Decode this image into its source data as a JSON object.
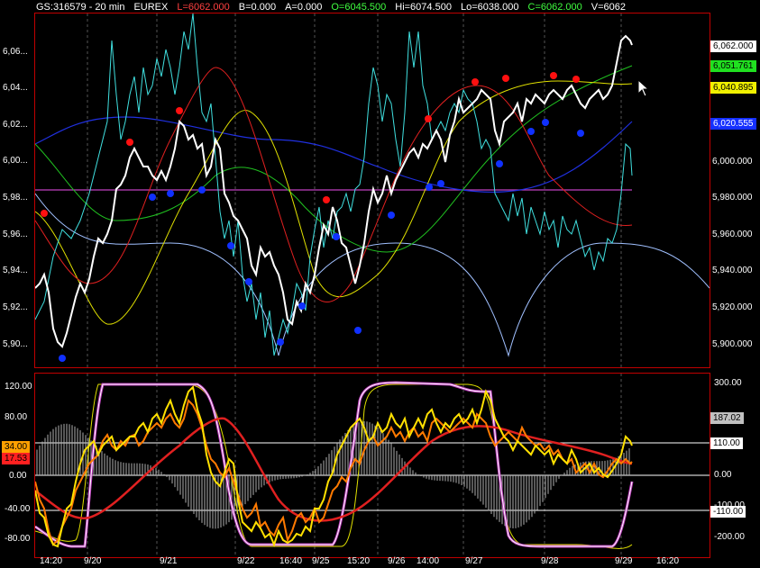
{
  "header": {
    "symbol": "GS:316579 - 20 min",
    "exchange": "EUREX",
    "last": "L=6062.000",
    "bid": "B=0.000",
    "ask": "A=0.000",
    "open": "O=6045.500",
    "high": "Hi=6074.500",
    "low": "Lo=6038.000",
    "close": "C=6062.000",
    "volume": "V=6062"
  },
  "price_axis": {
    "left_ticks": [
      "6,06...",
      "6,04...",
      "6,02...",
      "6,00...",
      "5,98...",
      "5,96...",
      "5,94...",
      "5,92...",
      "5,90..."
    ],
    "right_ticks": [
      "6,000.000",
      "5,980.000",
      "5,960.000",
      "5,940.000",
      "5,920.000",
      "5,900.000"
    ],
    "tags": {
      "last": "6,062.000",
      "green": "6,051.761",
      "yellow": "6,040.895",
      "blue": "6,020.555"
    }
  },
  "osc_axis": {
    "left_ticks": [
      "120.00",
      "80.00",
      "0.00",
      "-40.00",
      "-80.00"
    ],
    "left_tags": {
      "a": "34.00",
      "b": "17.53"
    },
    "right_ticks": [
      "300.00",
      "0.00",
      "-100.00",
      "-200.00"
    ],
    "right_tags": {
      "a": "187.02",
      "b": "110.00",
      "c": "-110.00"
    }
  },
  "time_axis": [
    "14:20",
    "9/20",
    "9/21",
    "9/22",
    "16:40",
    "9/25",
    "15:20",
    "9/26",
    "14:00",
    "9/27",
    "9/28",
    "9/29",
    "16:20"
  ],
  "colors": {
    "frame": "#c00000",
    "price": "#ffffff",
    "cyan": "#40e0e0",
    "red": "#e02020",
    "green": "#20c020",
    "yellow": "#e0e000",
    "blue": "#2020e0",
    "lightblue": "#a0c0ff",
    "magenta": "#c040c0",
    "orange": "#ff7a00"
  }
}
